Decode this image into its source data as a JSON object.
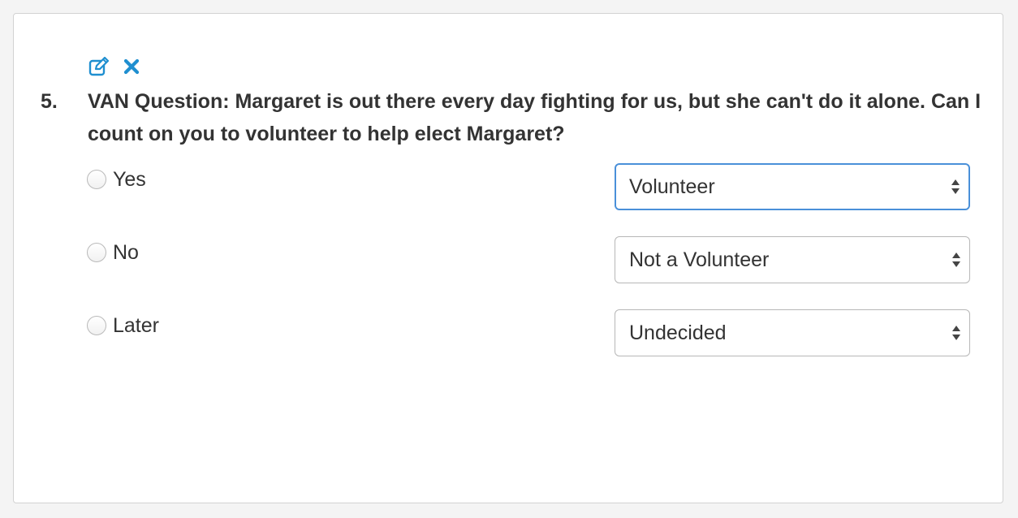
{
  "question": {
    "number": "5.",
    "text": "VAN Question: Margaret is out there every day fighting for us, but she can't do it alone. Can I count on you to volunteer to help elect Margaret?"
  },
  "actions": {
    "edit_icon": "edit-icon",
    "delete_icon": "close-icon"
  },
  "options": [
    {
      "label": "Yes",
      "mapped_value": "Volunteer"
    },
    {
      "label": "No",
      "mapped_value": "Not a Volunteer"
    },
    {
      "label": "Later",
      "mapped_value": "Undecided"
    }
  ],
  "colors": {
    "accent": "#1f8fd0",
    "focus_border": "#4a90d9",
    "text": "#333333"
  }
}
